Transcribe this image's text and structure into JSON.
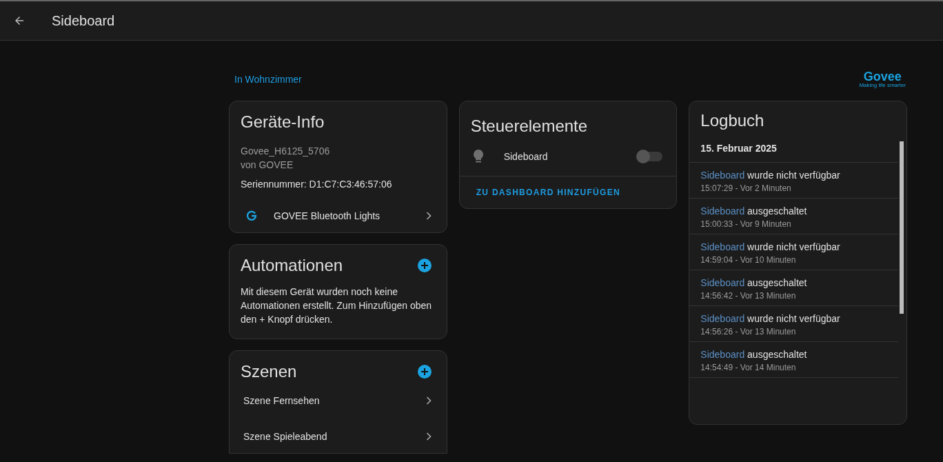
{
  "header": {
    "title": "Sideboard"
  },
  "area_link": "In Wohnzimmer",
  "brand_logo": {
    "name": "Govee",
    "tagline": "Making life smarter"
  },
  "device_info": {
    "title": "Geräte-Info",
    "model": "Govee_H6125_5706",
    "manufacturer": "von GOVEE",
    "serial": "Seriennummer: D1:C7:C3:46:57:06",
    "integration": "GOVEE Bluetooth Lights"
  },
  "automations": {
    "title": "Automationen",
    "text": "Mit diesem Gerät wurden noch keine Automationen erstellt. Zum Hinzufügen oben den + Knopf drücken."
  },
  "scenes": {
    "title": "Szenen",
    "items": [
      "Szene Fernsehen",
      "Szene Spieleabend"
    ]
  },
  "controls": {
    "title": "Steuerelemente",
    "entities": [
      {
        "name": "Sideboard",
        "on": false
      }
    ],
    "action": "ZU DASHBOARD HINZUFÜGEN"
  },
  "logbook": {
    "title": "Logbuch",
    "date": "15. Februar 2025",
    "entries": [
      {
        "entity": "Sideboard",
        "message": "wurde nicht verfügbar",
        "time": "15:07:29 - Vor 2 Minuten"
      },
      {
        "entity": "Sideboard",
        "message": "ausgeschaltet",
        "time": "15:00:33 - Vor 9 Minuten"
      },
      {
        "entity": "Sideboard",
        "message": "wurde nicht verfügbar",
        "time": "14:59:04 - Vor 10 Minuten"
      },
      {
        "entity": "Sideboard",
        "message": "ausgeschaltet",
        "time": "14:56:42 - Vor 13 Minuten"
      },
      {
        "entity": "Sideboard",
        "message": "wurde nicht verfügbar",
        "time": "14:56:26 - Vor 13 Minuten"
      },
      {
        "entity": "Sideboard",
        "message": "ausgeschaltet",
        "time": "14:54:49 - Vor 14 Minuten"
      }
    ]
  }
}
